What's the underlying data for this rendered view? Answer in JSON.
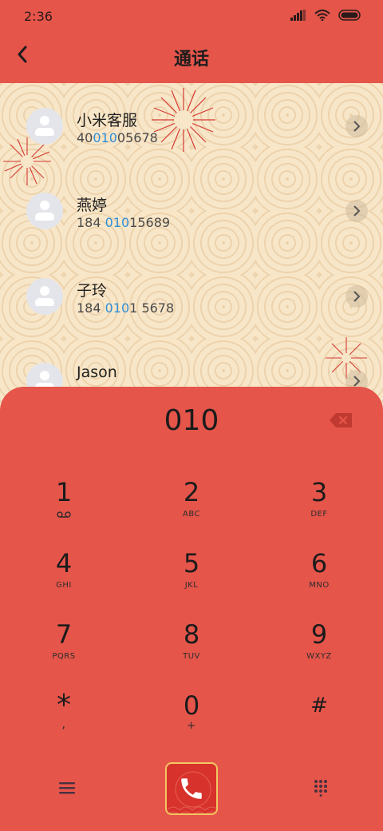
{
  "status": {
    "time": "2:36"
  },
  "header": {
    "title": "通话"
  },
  "contacts": [
    {
      "name": "小米客服",
      "num_pre": "40",
      "num_hl": "010",
      "num_post": "05678"
    },
    {
      "name": "燕婷",
      "num_pre": "184 ",
      "num_hl": "010",
      "num_post": "15689"
    },
    {
      "name": "子玲",
      "num_pre": "184 ",
      "num_hl": "010",
      "num_post": "1 5678"
    },
    {
      "name": "Jason",
      "num_pre": "",
      "num_hl": "",
      "num_post": ""
    }
  ],
  "dialer": {
    "input": "010",
    "keys": [
      {
        "digit": "1",
        "letters": ""
      },
      {
        "digit": "2",
        "letters": "ABC"
      },
      {
        "digit": "3",
        "letters": "DEF"
      },
      {
        "digit": "4",
        "letters": "GHI"
      },
      {
        "digit": "5",
        "letters": "JKL"
      },
      {
        "digit": "6",
        "letters": "MNO"
      },
      {
        "digit": "7",
        "letters": "PQRS"
      },
      {
        "digit": "8",
        "letters": "TUV"
      },
      {
        "digit": "9",
        "letters": "WXYZ"
      },
      {
        "digit": "*",
        "letters": ","
      },
      {
        "digit": "0",
        "letters": "+"
      },
      {
        "digit": "#",
        "letters": ""
      }
    ]
  },
  "icons": {
    "back": "back-arrow-icon",
    "info": "chevron-right-icon",
    "backspace": "backspace-icon",
    "menu": "menu-icon",
    "call": "phone-icon",
    "keypad": "keypad-icon"
  },
  "colors": {
    "accent": "#e5554a",
    "background": "#f8e6c8",
    "highlight": "#2f8fd8",
    "call_button": "#d8322c",
    "call_border": "#f2c660"
  }
}
